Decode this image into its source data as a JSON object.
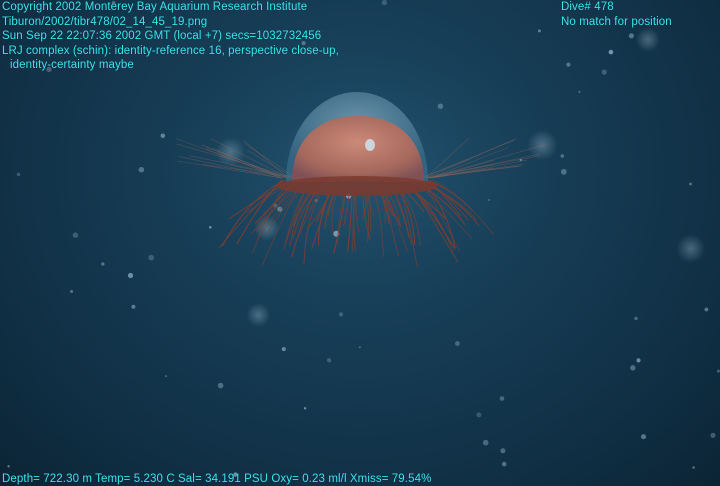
{
  "overlay": {
    "top_left": [
      "Copyright 2002 Monterey Bay Aquarium Research Institute",
      "Tiburon/2002/tibr478/02_14_45_19.png",
      "Sun Sep 22 22:07:36 2002 GMT (local +7)  secs=1032732456",
      "LRJ complex (schin): identity-reference 16, perspective close-up,",
      "identity-certainty maybe"
    ],
    "top_right": [
      "Dive# 478",
      "No match for position"
    ],
    "bottom": "Depth= 722.30 m  Temp= 5.230 C  Sal= 34.191 PSU  Oxy= 0.23 ml/l  Xmiss= 79.54%"
  },
  "colors": {
    "overlay_text": "#39e6ee",
    "water": "#153a52",
    "bell_inner": "#b5786a",
    "tentacles": "#8a3e2c"
  }
}
